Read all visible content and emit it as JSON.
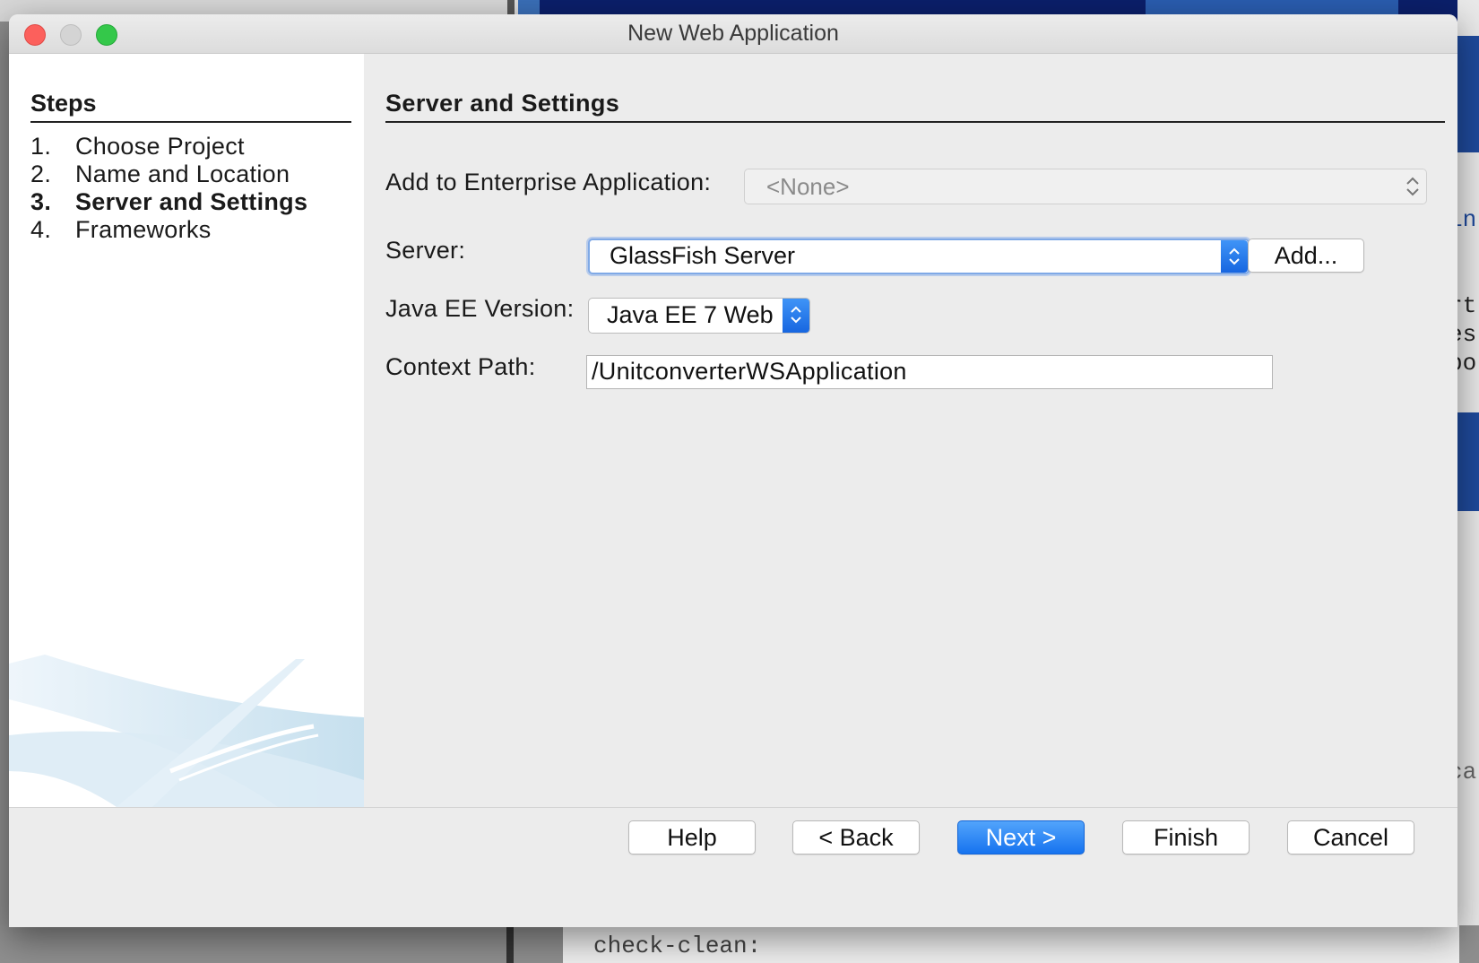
{
  "window": {
    "title": "New Web Application"
  },
  "steps": {
    "title": "Steps",
    "items": [
      {
        "num": "1.",
        "label": "Choose Project"
      },
      {
        "num": "2.",
        "label": "Name and Location"
      },
      {
        "num": "3.",
        "label": "Server and Settings",
        "active": true
      },
      {
        "num": "4.",
        "label": "Frameworks"
      }
    ]
  },
  "main": {
    "title": "Server and Settings",
    "enterprise": {
      "label": "Add to Enterprise Application:",
      "value": "<None>"
    },
    "server": {
      "label": "Server:",
      "value": "GlassFish Server",
      "add_label": "Add..."
    },
    "javaee": {
      "label": "Java EE Version:",
      "value": "Java EE 7 Web"
    },
    "context": {
      "label": "Context Path:",
      "value": "/UnitconverterWSApplication"
    }
  },
  "footer": {
    "help": "Help",
    "back": "< Back",
    "next": "Next >",
    "finish": "Finish",
    "cancel": "Cancel"
  },
  "background": {
    "right_fragments": [
      "in",
      "rt",
      "es",
      "po",
      "ca"
    ],
    "code_text": "check-clean:"
  },
  "colors": {
    "accent": "#1673ef",
    "focus_ring": "#7fa9e6"
  }
}
